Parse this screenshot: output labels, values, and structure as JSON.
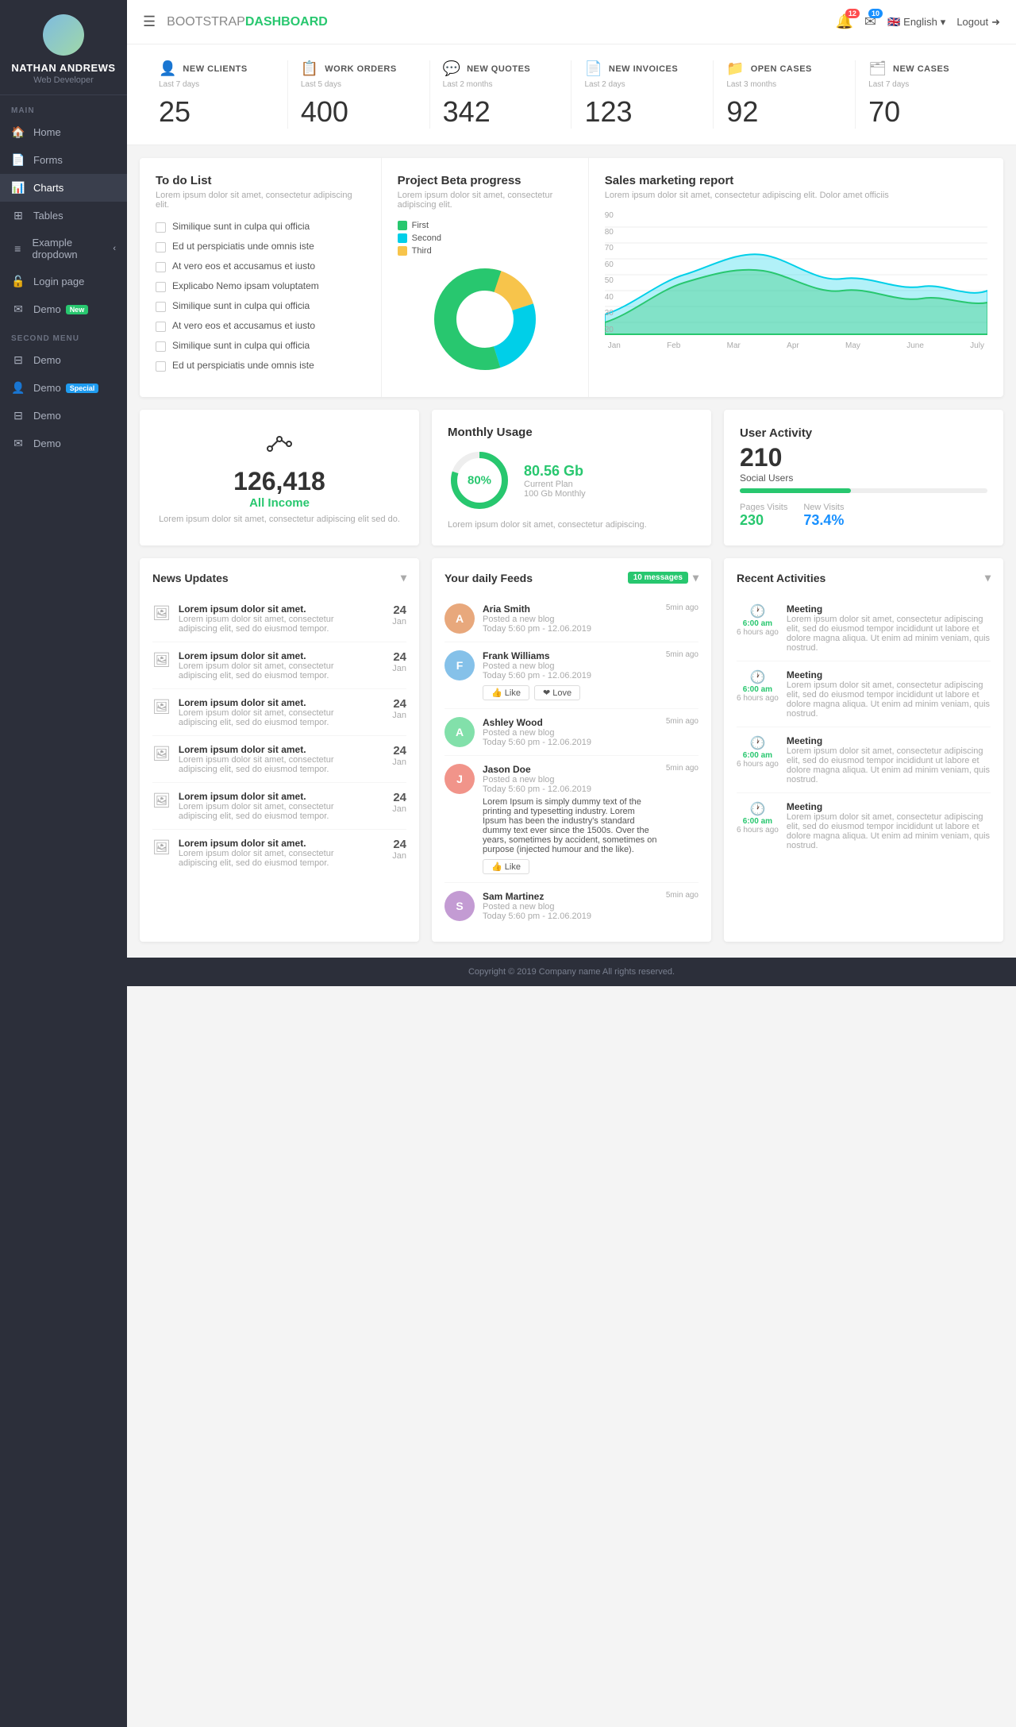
{
  "sidebar": {
    "user": {
      "name": "NATHAN ANDREWS",
      "role": "Web Developer"
    },
    "main_label": "MAIN",
    "second_label": "SECOND MENU",
    "items_main": [
      {
        "label": "Home",
        "icon": "🏠",
        "active": false
      },
      {
        "label": "Forms",
        "icon": "📄",
        "active": false
      },
      {
        "label": "Charts",
        "icon": "📊",
        "active": true
      },
      {
        "label": "Tables",
        "icon": "⊞",
        "active": false
      },
      {
        "label": "Example dropdown",
        "icon": "≡",
        "active": false,
        "arrow": "‹"
      },
      {
        "label": "Login page",
        "icon": "🔓",
        "active": false
      },
      {
        "label": "Demo",
        "icon": "✉",
        "active": false,
        "badge": "New",
        "badge_type": "green"
      }
    ],
    "items_second": [
      {
        "label": "Demo",
        "icon": "⊟",
        "active": false
      },
      {
        "label": "Demo",
        "icon": "👤",
        "active": false,
        "badge": "Special",
        "badge_type": "blue"
      },
      {
        "label": "Demo",
        "icon": "⊟",
        "active": false
      },
      {
        "label": "Demo",
        "icon": "✉",
        "active": false
      }
    ]
  },
  "topnav": {
    "brand_light": "BOOTSTRAP",
    "brand_bold": "DASHBOARD",
    "bell_count": "12",
    "mail_count": "10",
    "lang": "English",
    "logout": "Logout"
  },
  "stats": [
    {
      "icon": "👤",
      "title": "NEW CLIENTS",
      "sub": "Last 7 days",
      "value": "25"
    },
    {
      "icon": "📋",
      "title": "WORK ORDERS",
      "sub": "Last 5 days",
      "value": "400"
    },
    {
      "icon": "💬",
      "title": "NEW QUOTES",
      "sub": "Last 2 months",
      "value": "342"
    },
    {
      "icon": "📄",
      "title": "NEW INVOICES",
      "sub": "Last 2 days",
      "value": "123"
    },
    {
      "icon": "📁",
      "title": "OPEN CASES",
      "sub": "Last 3 months",
      "value": "92"
    },
    {
      "icon": "🗂",
      "title": "NEW CASES",
      "sub": "Last 7 days",
      "value": "70"
    }
  ],
  "todo": {
    "title": "To do List",
    "desc": "Lorem ipsum dolor sit amet, consectetur adipiscing elit.",
    "items": [
      "Similique sunt in culpa qui officia",
      "Ed ut perspiciatis unde omnis iste",
      "At vero eos et accusamus et iusto",
      "Explicabo Nemo ipsam voluptatem",
      "Similique sunt in culpa qui officia",
      "At vero eos et accusamus et iusto",
      "Similique sunt in culpa qui officia",
      "Ed ut perspiciatis unde omnis iste"
    ]
  },
  "donut_chart": {
    "title": "Project Beta progress",
    "desc": "Lorem ipsum dolor sit amet, consectetur adipiscing elit.",
    "legend": [
      {
        "label": "First",
        "color": "#28c76f"
      },
      {
        "label": "Second",
        "color": "#00cfe8"
      },
      {
        "label": "Third",
        "color": "#f7c44b"
      }
    ],
    "values": [
      55,
      25,
      20
    ]
  },
  "sales": {
    "title": "Sales marketing report",
    "desc": "Lorem ipsum dolor sit amet, consectetur adipiscing elit. Dolor amet officiis",
    "x_labels": [
      "Jan",
      "Feb",
      "Mar",
      "Apr",
      "May",
      "June",
      "July"
    ],
    "y_labels": [
      "20",
      "30",
      "40",
      "50",
      "60",
      "70",
      "80",
      "90"
    ]
  },
  "income_widget": {
    "value": "126,418",
    "label": "All Income",
    "desc": "Lorem ipsum dolor sit amet, consectetur adipiscing elit sed do."
  },
  "usage_widget": {
    "title": "Monthly Usage",
    "percent": 80,
    "gb": "80.56 Gb",
    "plan": "Current Plan",
    "plan_detail": "100 Gb Monthly",
    "desc": "Lorem ipsum dolor sit amet, consectetur adipiscing."
  },
  "activity_widget": {
    "title": "User Activity",
    "count": "210",
    "sub": "Social Users",
    "bar_percent": 45,
    "pages_label": "Pages Visits",
    "pages_value": "230",
    "new_label": "New Visits",
    "new_value": "73.4%"
  },
  "news": {
    "title": "News Updates",
    "items": [
      {
        "title": "Lorem ipsum dolor sit amet.",
        "body": "Lorem ipsum dolor sit amet, consectetur adipiscing elit, sed do eiusmod tempor.",
        "day": "24",
        "month": "Jan"
      },
      {
        "title": "Lorem ipsum dolor sit amet.",
        "body": "Lorem ipsum dolor sit amet, consectetur adipiscing elit, sed do eiusmod tempor.",
        "day": "24",
        "month": "Jan"
      },
      {
        "title": "Lorem ipsum dolor sit amet.",
        "body": "Lorem ipsum dolor sit amet, consectetur adipiscing elit, sed do eiusmod tempor.",
        "day": "24",
        "month": "Jan"
      },
      {
        "title": "Lorem ipsum dolor sit amet.",
        "body": "Lorem ipsum dolor sit amet, consectetur adipiscing elit, sed do eiusmod tempor.",
        "day": "24",
        "month": "Jan"
      },
      {
        "title": "Lorem ipsum dolor sit amet.",
        "body": "Lorem ipsum dolor sit amet, consectetur adipiscing elit, sed do eiusmod tempor.",
        "day": "24",
        "month": "Jan"
      },
      {
        "title": "Lorem ipsum dolor sit amet.",
        "body": "Lorem ipsum dolor sit amet, consectetur adipiscing elit, sed do eiusmod tempor.",
        "day": "24",
        "month": "Jan"
      }
    ]
  },
  "feeds": {
    "title": "Your daily Feeds",
    "badge": "10 messages",
    "items": [
      {
        "name": "Aria Smith",
        "sub": "Posted a new blog",
        "date": "Today 5:60 pm - 12.06.2019",
        "time": "5min ago",
        "avatar_color": "#e8a87c",
        "actions": []
      },
      {
        "name": "Frank Williams",
        "sub": "Posted a new blog",
        "date": "Today 5:60 pm - 12.06.2019",
        "time": "5min ago",
        "avatar_color": "#85c1e9",
        "actions": [
          "👍 Like",
          "❤ Love"
        ]
      },
      {
        "name": "Ashley Wood",
        "sub": "Posted a new blog",
        "date": "Today 5:60 pm - 12.06.2019",
        "time": "5min ago",
        "avatar_color": "#82e0aa",
        "actions": []
      },
      {
        "name": "Jason Doe",
        "sub": "Posted a new blog",
        "date": "Today 5:60 pm - 12.06.2019",
        "time": "5min ago",
        "avatar_color": "#f1948a",
        "actions": [],
        "extended": "Lorem Ipsum is simply dummy text of the printing and typesetting industry. Lorem Ipsum has been the industry's standard dummy text ever since the 1500s. Over the years, sometimes by accident, sometimes on purpose (injected humour and the like).",
        "like_btn": "👍 Like"
      },
      {
        "name": "Sam Martinez",
        "sub": "Posted a new blog",
        "date": "Today 5:60 pm - 12.06.2019",
        "time": "5min ago",
        "avatar_color": "#c39bd3",
        "actions": []
      }
    ]
  },
  "recent": {
    "title": "Recent Activities",
    "items": [
      {
        "title": "Meeting",
        "time_top": "6:00 am",
        "time_bot": "6 hours ago",
        "body": "Lorem ipsum dolor sit amet, consectetur adipiscing elit, sed do eiusmod tempor incididunt ut labore et dolore magna aliqua. Ut enim ad minim veniam, quis nostrud."
      },
      {
        "title": "Meeting",
        "time_top": "6:00 am",
        "time_bot": "6 hours ago",
        "body": "Lorem ipsum dolor sit amet, consectetur adipiscing elit, sed do eiusmod tempor incididunt ut labore et dolore magna aliqua. Ut enim ad minim veniam, quis nostrud."
      },
      {
        "title": "Meeting",
        "time_top": "6:00 am",
        "time_bot": "6 hours ago",
        "body": "Lorem ipsum dolor sit amet, consectetur adipiscing elit, sed do eiusmod tempor incididunt ut labore et dolore magna aliqua. Ut enim ad minim veniam, quis nostrud."
      },
      {
        "title": "Meeting",
        "time_top": "6:00 am",
        "time_bot": "6 hours ago",
        "body": "Lorem ipsum dolor sit amet, consectetur adipiscing elit, sed do eiusmod tempor incididunt ut labore et dolore magna aliqua. Ut enim ad minim veniam, quis nostrud."
      }
    ]
  },
  "footer": {
    "text": "Copyright © 2019 Company name All rights reserved."
  }
}
